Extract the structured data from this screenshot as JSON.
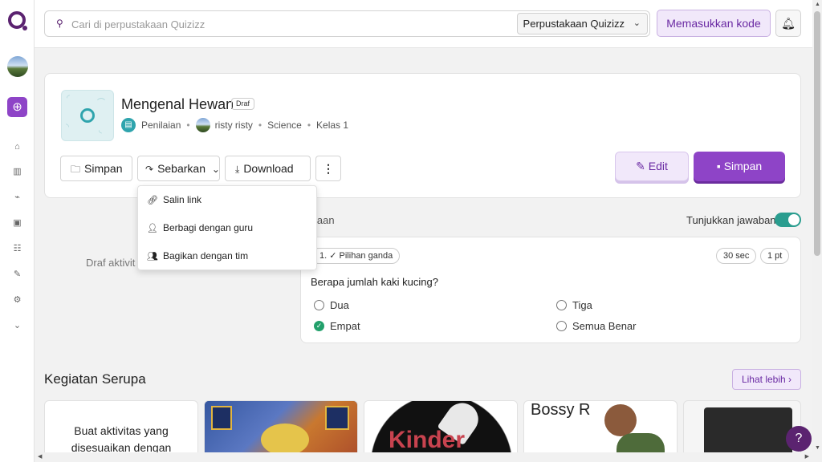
{
  "topbar": {
    "search_placeholder": "Cari di perpustakaan Quizizz",
    "library_select": "Perpustakaan Quizizz",
    "enter_code": "Memasukkan kode"
  },
  "quiz": {
    "title": "Mengenal Hewan",
    "status": "Draf",
    "type": "Penilaian",
    "author": "risty risty",
    "subject": "Science",
    "grade": "Kelas 1"
  },
  "actions": {
    "save": "Simpan",
    "share": "Sebarkan",
    "download": "Download",
    "edit": "Edit",
    "save_primary": "Simpan"
  },
  "share_menu": {
    "items": [
      {
        "label": "Salin link",
        "icon": "link-icon"
      },
      {
        "label": "Berbagi dengan guru",
        "icon": "person-icon"
      },
      {
        "label": "Bagikan dengan tim",
        "icon": "team-icon"
      }
    ]
  },
  "questions": {
    "header": "Pertanyaan",
    "header_visible": "rtanyaan",
    "show_answers": "Tunjukkan jawaban",
    "draft_label": "Draf aktivit",
    "items": [
      {
        "number": "1.",
        "type": "Pilihan ganda",
        "time": "30 sec",
        "points": "1 pt",
        "text": "Berapa jumlah kaki kucing?",
        "options": [
          {
            "label": "Dua",
            "correct": false
          },
          {
            "label": "Tiga",
            "correct": false
          },
          {
            "label": "Empat",
            "correct": true
          },
          {
            "label": "Semua Benar",
            "correct": false
          }
        ]
      }
    ]
  },
  "similar": {
    "title": "Kegiatan Serupa",
    "see_more": "Lihat lebih",
    "create_card_line1": "Buat aktivitas yang",
    "create_card_line2": "disesuaikan dengan",
    "card_texts": [
      "Kinder",
      "Bossy R"
    ]
  },
  "help": "?",
  "colors": {
    "brand": "#5b2370",
    "accent": "#8e44c7",
    "teal": "#2fa4ad",
    "correct": "#22a06b"
  }
}
